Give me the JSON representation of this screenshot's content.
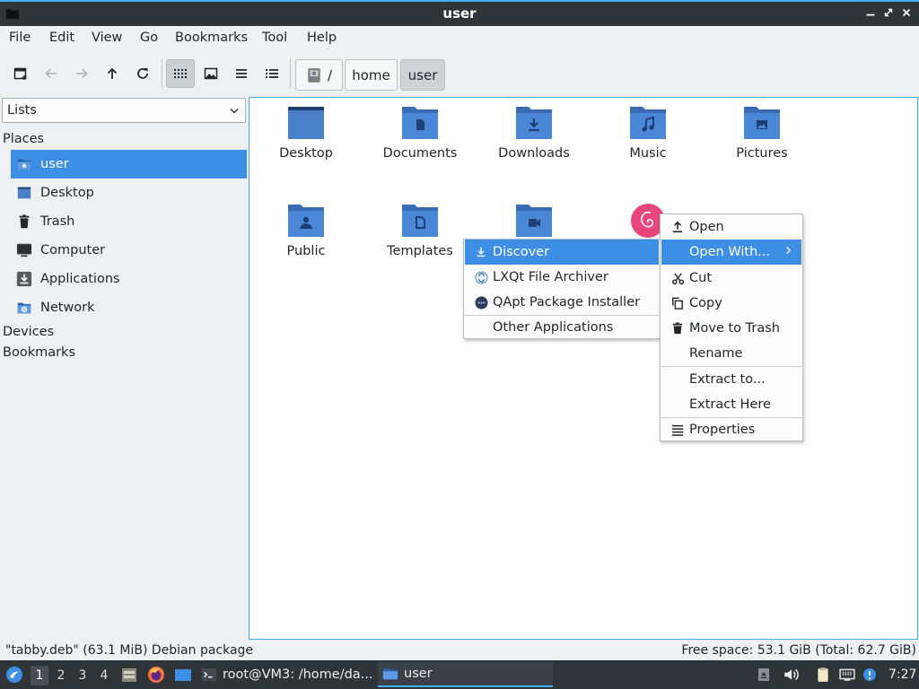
{
  "window": {
    "title": "user"
  },
  "menubar": [
    "File",
    "Edit",
    "View",
    "Go",
    "Bookmarks",
    "Tool",
    "Help"
  ],
  "breadcrumb": {
    "root": "/",
    "parts": [
      "home",
      "user"
    ]
  },
  "sidebar": {
    "view_mode": "Lists",
    "places_header": "Places",
    "places": [
      "user",
      "Desktop",
      "Trash",
      "Computer",
      "Applications",
      "Network"
    ],
    "devices_header": "Devices",
    "bookmarks_header": "Bookmarks"
  },
  "files": [
    "Desktop",
    "Documents",
    "Downloads",
    "Music",
    "Pictures",
    "Public",
    "Templates",
    "Videos",
    "tabby.deb"
  ],
  "context_menu": {
    "items": [
      "Open",
      "Open With...",
      "Cut",
      "Copy",
      "Move to Trash",
      "Rename",
      "Extract to...",
      "Extract Here",
      "Properties"
    ]
  },
  "open_with_menu": {
    "items": [
      "Discover",
      "LXQt File Archiver",
      "QApt Package Installer",
      "Other Applications"
    ]
  },
  "status": {
    "left": "\"tabby.deb\" (63.1 MiB) Debian package",
    "right": "Free space: 53.1 GiB (Total: 62.7 GiB)"
  },
  "taskbar": {
    "desktops": [
      "1",
      "2",
      "3",
      "4"
    ],
    "tasks": [
      "root@VM3: /home/da...",
      "user"
    ],
    "clock": "7:27"
  },
  "colors": {
    "accent": "#3daee9",
    "folder": "#4a7fc9",
    "folder_tab": "#3a6cb5",
    "selection": "#3d8ee5"
  }
}
